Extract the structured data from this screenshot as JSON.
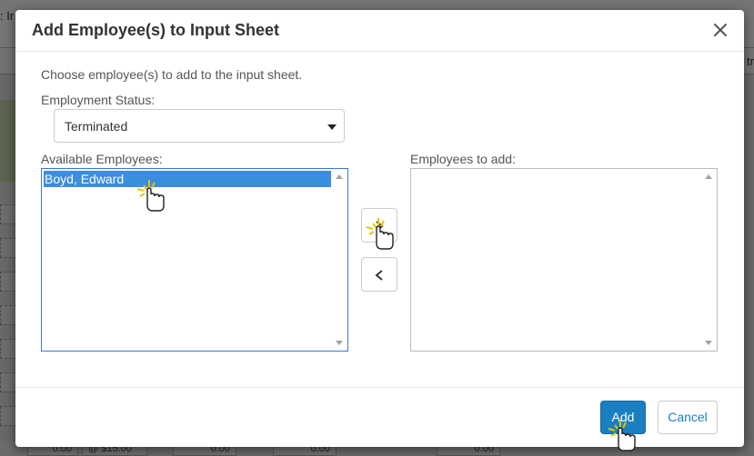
{
  "background": {
    "topbar_text": ": Ir",
    "header_right_text": "tr",
    "bottom_cells": [
      "0.00",
      "@ $15.00",
      "0.00",
      "0.00",
      "0.00"
    ]
  },
  "modal": {
    "title": "Add Employee(s) to Input Sheet",
    "intro": "Choose employee(s) to add to the input sheet.",
    "status_label": "Employment Status:",
    "status_value": "Terminated",
    "available_label": "Available Employees:",
    "to_add_label": "Employees to add:",
    "available_employees": [
      "Boyd, Edward"
    ],
    "employees_to_add": [],
    "add_button": "Add",
    "cancel_button": "Cancel"
  },
  "colors": {
    "primary": "#1a7fc1",
    "selected_row": "#3b8dde",
    "highlight_border": "#3c78d8"
  }
}
